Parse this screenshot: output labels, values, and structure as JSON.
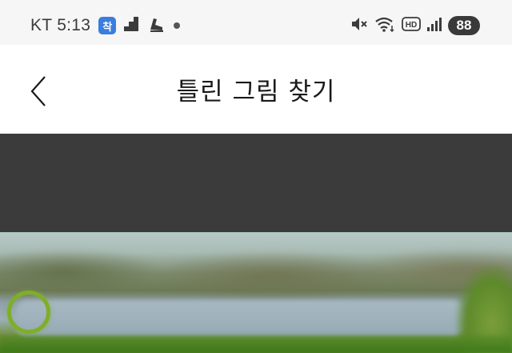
{
  "status_bar": {
    "carrier_time": "KT 5:13",
    "app_badge": "착",
    "battery": "88",
    "icons": [
      "app-badge-icon",
      "signal-bars-small-icon",
      "shoe-icon",
      "notification-dot-icon",
      "mute-icon",
      "wifi-icon",
      "hd-icon",
      "cell-signal-icon"
    ]
  },
  "app_bar": {
    "title": "틀린 그림 찾기",
    "back_icon": "chevron-left-icon"
  },
  "puzzle": {
    "image": "blurred landscape of lake with mountains and grass",
    "marker_color": "#7fae2a"
  },
  "colors": {
    "status_bg": "#f6f6f6",
    "app_bar_bg": "#ffffff",
    "dark_band": "#3b3b3b",
    "marker": "#7fae2a"
  }
}
